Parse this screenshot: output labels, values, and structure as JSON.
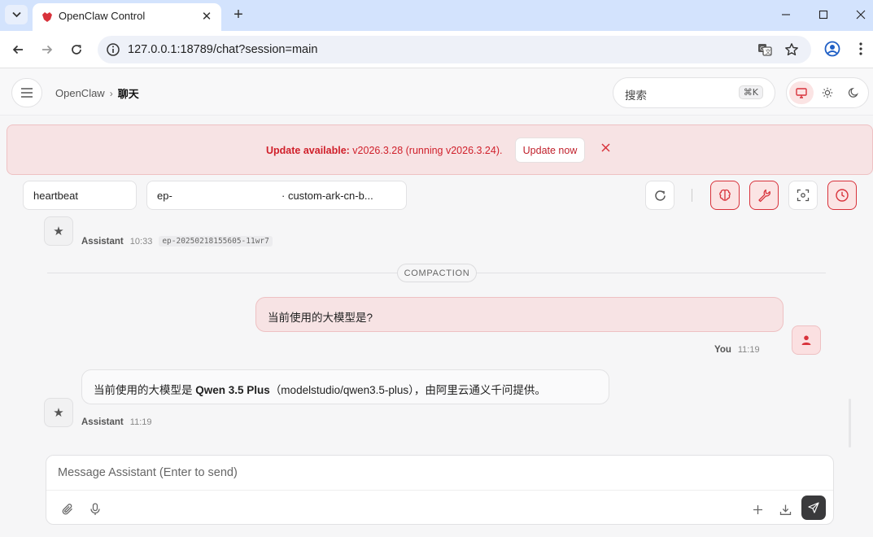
{
  "browser": {
    "tab_title": "OpenClaw Control",
    "url": "127.0.0.1:18789/chat?session=main"
  },
  "header": {
    "breadcrumb_root": "OpenClaw",
    "breadcrumb_separator": "›",
    "breadcrumb_current": "聊天",
    "search_placeholder": "搜索",
    "search_shortcut": "⌘K"
  },
  "banner": {
    "label": "Update available:",
    "text": " v2026.3.28 (running v2026.3.24).",
    "button": "Update now"
  },
  "controls": {
    "session": "heartbeat",
    "model_prefix": "ep-",
    "model_suffix": "· custom-ark-cn-b..."
  },
  "chat": {
    "prev_message": {
      "author": "Assistant",
      "time": "10:33",
      "model_tag": "ep-20250218155605-11wr7"
    },
    "divider": "COMPACTION",
    "user_message": {
      "text": "当前使用的大模型是?",
      "author": "You",
      "time": "11:19"
    },
    "assistant_message": {
      "text_before": "当前使用的大模型是 ",
      "text_bold": "Qwen 3.5 Plus",
      "text_after": "（modelstudio/qwen3.5-plus），由阿里云通义千问提供。",
      "author": "Assistant",
      "time": "11:19"
    }
  },
  "composer": {
    "placeholder": "Message Assistant (Enter to send)"
  },
  "colors": {
    "accent": "#d8323b",
    "banner_bg": "#f7e3e4",
    "tabstrip_bg": "#d3e3fd"
  }
}
